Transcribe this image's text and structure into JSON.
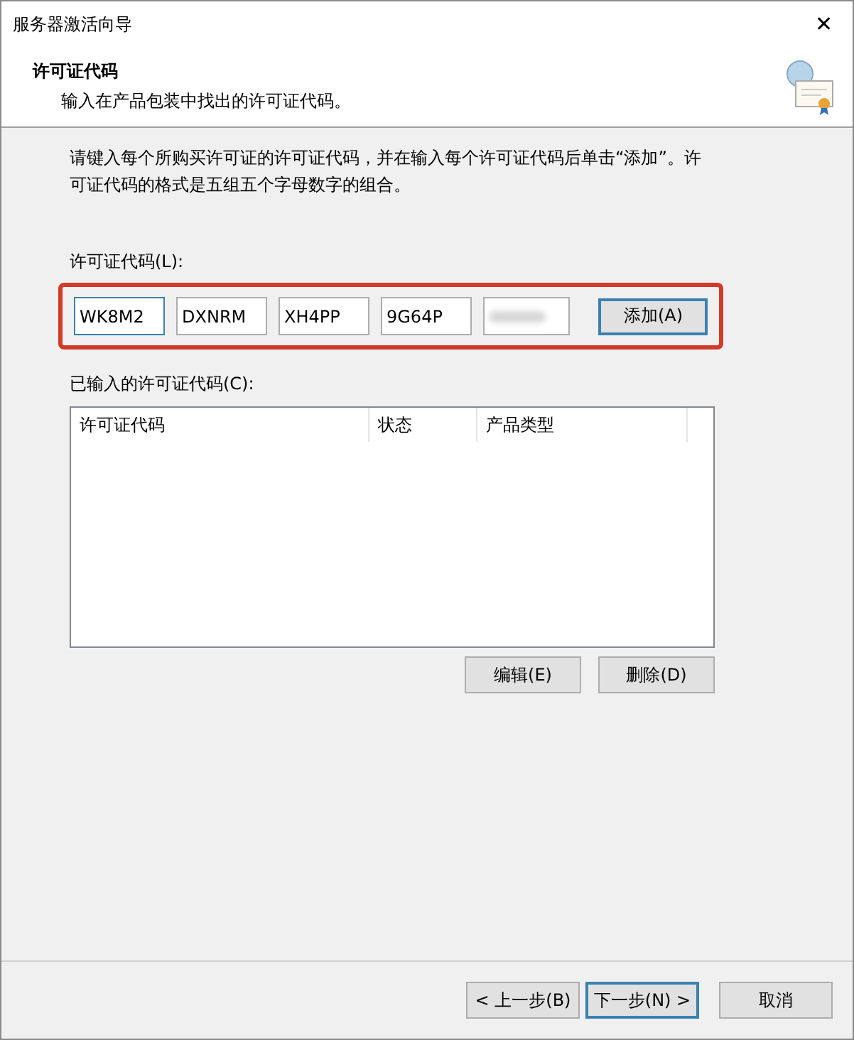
{
  "window": {
    "title": "服务器激活向导",
    "close": "✕"
  },
  "header": {
    "title": "许可证代码",
    "subtitle": "输入在产品包装中找出的许可证代码。"
  },
  "intro": "请键入每个所购买许可证的许可证代码，并在输入每个许可证代码后单击“添加”。许可证代码的格式是五组五个字母数字的组合。",
  "key_label": "许可证代码(L):",
  "key_fields": [
    {
      "value": "WK8M2",
      "focused": true,
      "obscured": false
    },
    {
      "value": "DXNRM",
      "focused": false,
      "obscured": false
    },
    {
      "value": "XH4PP",
      "focused": false,
      "obscured": false
    },
    {
      "value": "9G64P",
      "focused": false,
      "obscured": false
    },
    {
      "focused": false,
      "obscured": true
    }
  ],
  "add_button": {
    "label": "添加(A)",
    "default": true
  },
  "entered_label": "已输入的许可证代码(C):",
  "table": {
    "columns": [
      "许可证代码",
      "状态",
      "产品类型"
    ]
  },
  "list_buttons": [
    {
      "label": "编辑(E)",
      "default": false
    },
    {
      "label": "删除(D)",
      "default": false
    }
  ],
  "footer_buttons": [
    {
      "label": "< 上一步(B)",
      "default": false
    },
    {
      "label": "下一步(N) >",
      "default": true
    },
    {
      "label": "取消",
      "default": false
    }
  ]
}
